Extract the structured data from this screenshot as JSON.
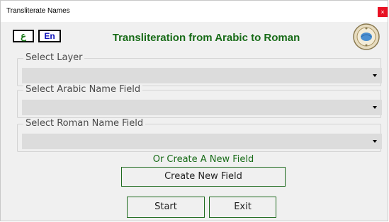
{
  "window": {
    "title": "Transliterate Names",
    "close_label": "×"
  },
  "header": {
    "arabic_button": "ع",
    "english_button": "En",
    "title": "Transliteration from Arabic to Roman"
  },
  "groups": {
    "layer": {
      "label": "Select Layer",
      "value": ""
    },
    "arabic_field": {
      "label": "Select Arabic Name Field",
      "value": ""
    },
    "roman_field": {
      "label": "Select Roman Name Field",
      "value": ""
    }
  },
  "create": {
    "prompt": "Or Create A New Field",
    "button_label": "Create New Field"
  },
  "actions": {
    "start_label": "Start",
    "exit_label": "Exit"
  },
  "colors": {
    "accent_green": "#176b17",
    "english_blue": "#0c10b8",
    "close_red": "#e81123",
    "combo_gray": "#dcdcdc"
  },
  "icons": {
    "logo": "government-seal-icon",
    "dropdown": "chevron-down-icon"
  }
}
